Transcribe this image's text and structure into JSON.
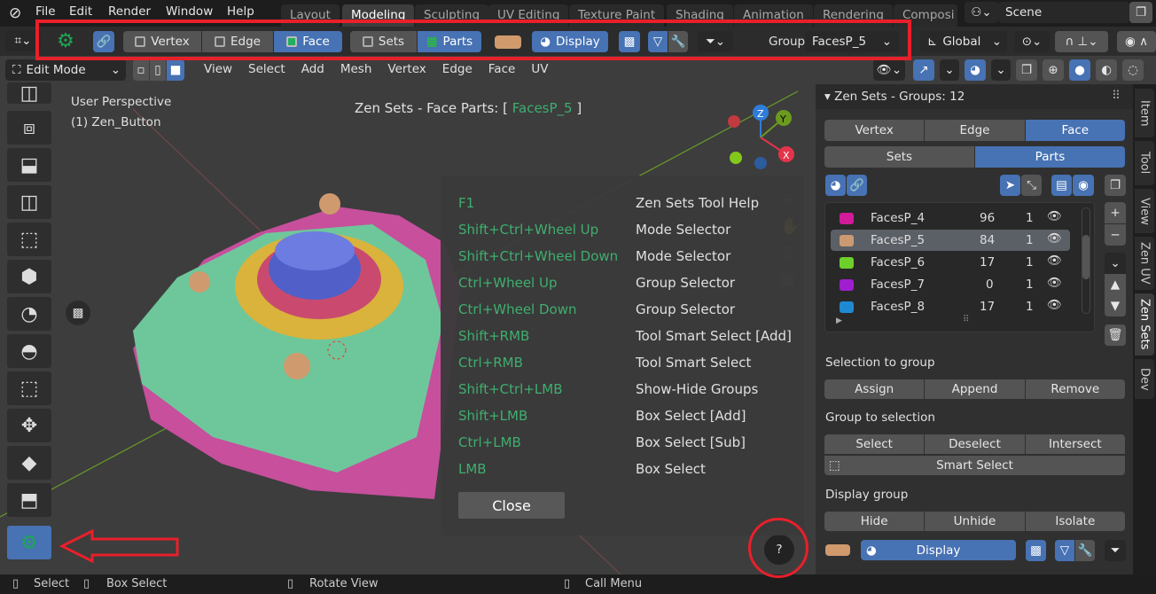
{
  "menubar": {
    "items": [
      "File",
      "Edit",
      "Render",
      "Window",
      "Help"
    ],
    "workspaces": [
      "Layout",
      "Modeling",
      "Sculpting",
      "UV Editing",
      "Texture Paint",
      "Shading",
      "Animation",
      "Rendering",
      "Composi"
    ],
    "active_workspace": "Modeling",
    "scene": "Scene"
  },
  "tool_header": {
    "vertex": "Vertex",
    "edge": "Edge",
    "face": "Face",
    "sets": "Sets",
    "parts": "Parts",
    "display": "Display",
    "group_label": "Group",
    "group_value": "FacesP_5",
    "orientation": "Global",
    "group_color": "#d09a6d"
  },
  "viewport_header": {
    "mode": "Edit Mode",
    "menus": [
      "View",
      "Select",
      "Add",
      "Mesh",
      "Vertex",
      "Edge",
      "Face",
      "UV"
    ]
  },
  "viewport": {
    "perspective": "User Perspective",
    "object": "(1) Zen_Button",
    "title_prefix": "Zen Sets - Face Parts: [",
    "title_group": "FacesP_5",
    "title_suffix": "]",
    "gizmo": {
      "z": "Z",
      "y": "Y",
      "x": "X"
    }
  },
  "help": {
    "rows": [
      {
        "key": "F1",
        "action": "Zen Sets Tool Help"
      },
      {
        "key": "Shift+Ctrl+Wheel Up",
        "action": "Mode Selector"
      },
      {
        "key": "Shift+Ctrl+Wheel Down",
        "action": "Mode Selector"
      },
      {
        "key": "Ctrl+Wheel Up",
        "action": "Group Selector"
      },
      {
        "key": "Ctrl+Wheel Down",
        "action": "Group Selector"
      },
      {
        "key": "Shift+RMB",
        "action": "Tool Smart Select [Add]"
      },
      {
        "key": "Ctrl+RMB",
        "action": "Tool Smart Select"
      },
      {
        "key": "Shift+Ctrl+LMB",
        "action": "Show-Hide Groups"
      },
      {
        "key": "Shift+LMB",
        "action": "Box Select [Add]"
      },
      {
        "key": "Ctrl+LMB",
        "action": "Box Select [Sub]"
      },
      {
        "key": "LMB",
        "action": "Box Select"
      }
    ],
    "close": "Close"
  },
  "panel": {
    "title": "Zen Sets - Groups: 12",
    "vertex": "Vertex",
    "edge": "Edge",
    "face": "Face",
    "sets": "Sets",
    "parts": "Parts",
    "groups": [
      {
        "name": "FacesP_4",
        "count": "96",
        "value": "1",
        "color": "#d21a9a"
      },
      {
        "name": "FacesP_5",
        "count": "84",
        "value": "1",
        "color": "#cc9a72",
        "selected": true
      },
      {
        "name": "FacesP_6",
        "count": "17",
        "value": "1",
        "color": "#6fcf2a"
      },
      {
        "name": "FacesP_7",
        "count": "0",
        "value": "1",
        "color": "#a11ed0"
      },
      {
        "name": "FacesP_8",
        "count": "17",
        "value": "1",
        "color": "#1e8ad4"
      }
    ],
    "selection_to_group": "Selection to group",
    "assign": "Assign",
    "append": "Append",
    "remove": "Remove",
    "group_to_selection": "Group to selection",
    "select": "Select",
    "deselect": "Deselect",
    "intersect": "Intersect",
    "smart_select": "Smart Select",
    "display_group": "Display group",
    "hide": "Hide",
    "unhide": "Unhide",
    "isolate": "Isolate",
    "display": "Display"
  },
  "side_tabs": [
    "Item",
    "Tool",
    "View",
    "Zen UV",
    "Zen Sets",
    "Dev"
  ],
  "status": {
    "select": "Select",
    "box_select": "Box Select",
    "rotate_view": "Rotate View",
    "call_menu": "Call Menu"
  }
}
